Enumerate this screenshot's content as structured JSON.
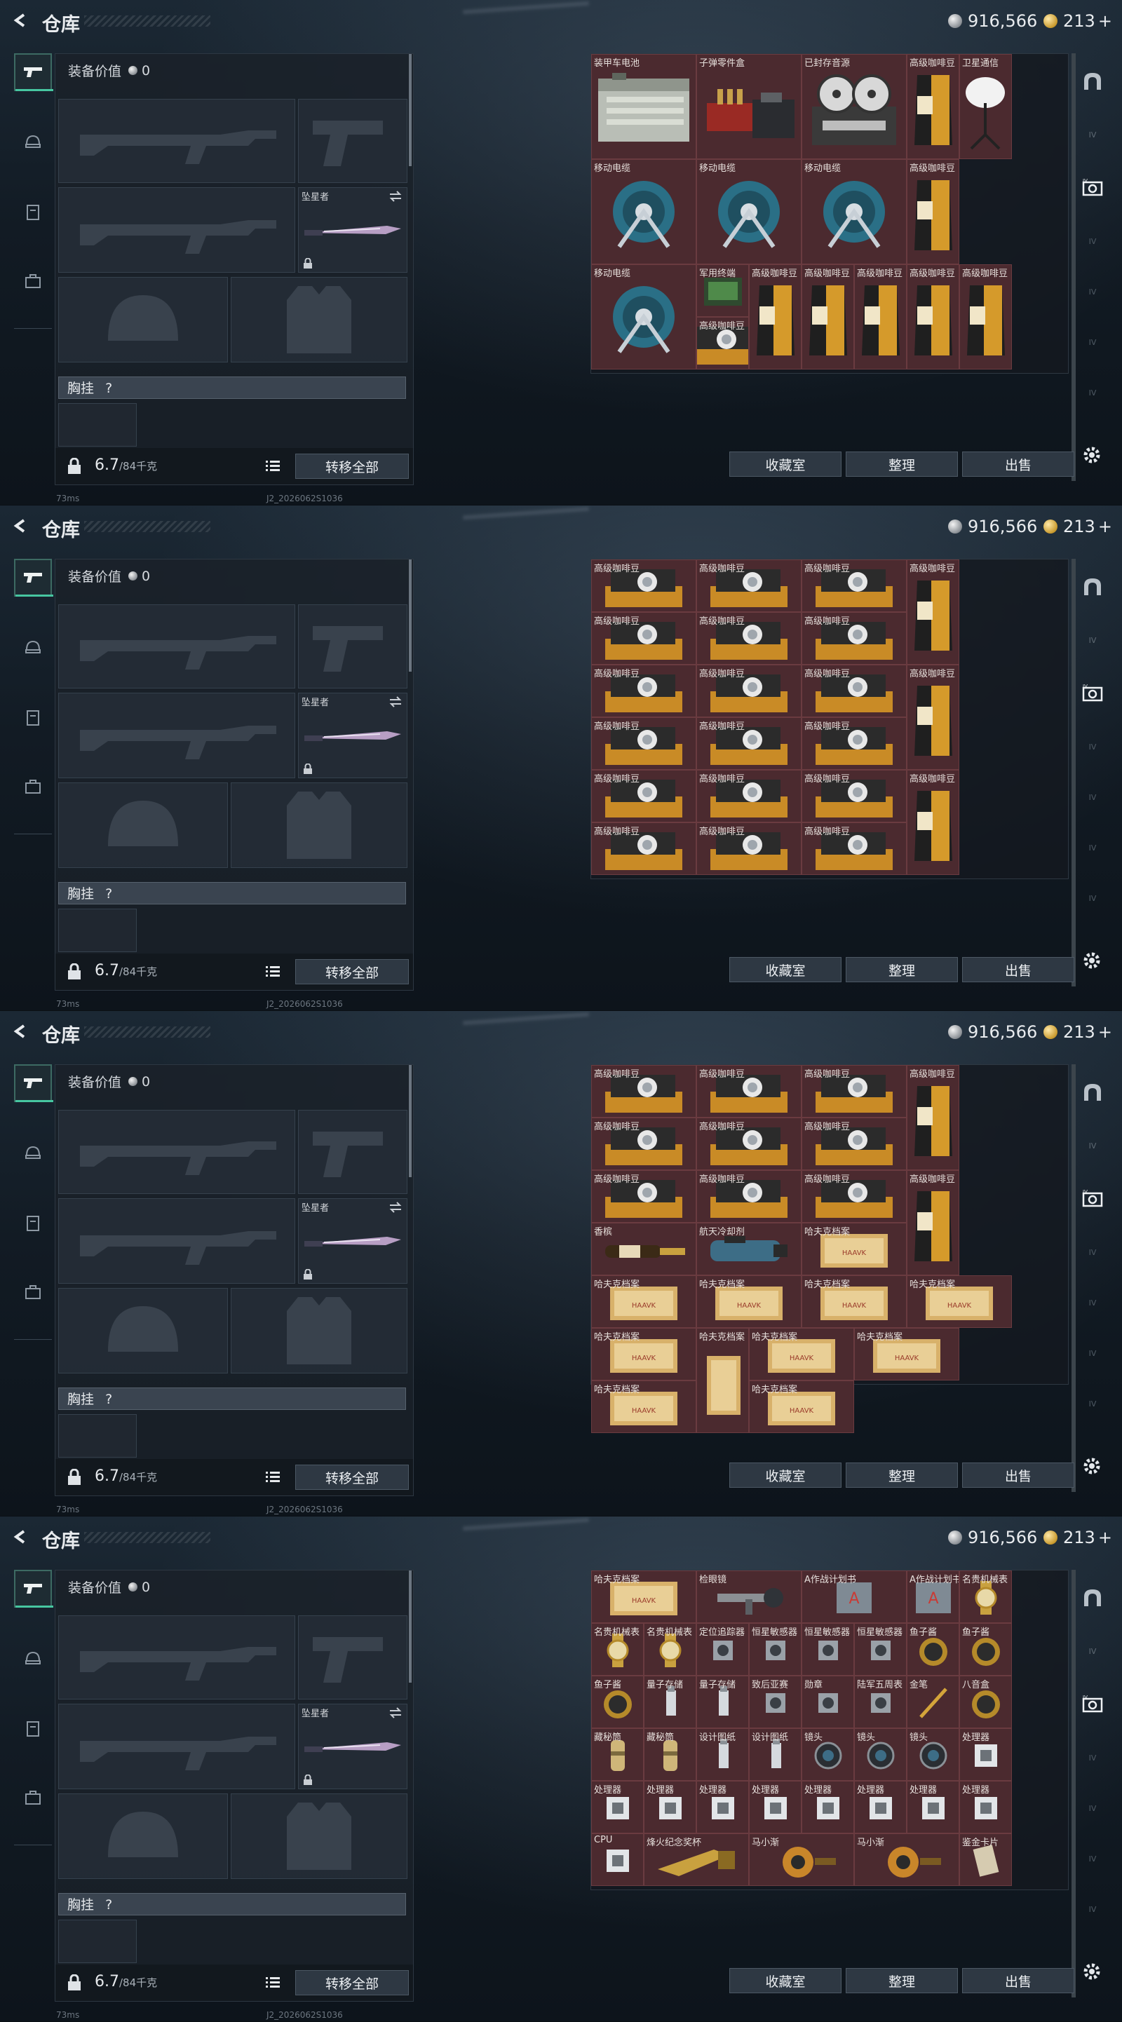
{
  "header": {
    "title": "仓库",
    "silver": "916,566",
    "gold": "213",
    "gold_suffix": "+"
  },
  "left_nav": [
    "weapon",
    "helmet",
    "armor",
    "backpack"
  ],
  "equipment": {
    "value_label": "装备价值",
    "value": "0",
    "melee_name": "坠星者",
    "chest_label": "胸挂",
    "chest_hint": "?",
    "weight": "6.7",
    "weight_cap": "/84千克",
    "transfer_all": "转移全部"
  },
  "inventory_buttons": {
    "collection": "收藏室",
    "sort": "整理",
    "sell": "出售"
  },
  "footer": {
    "ping": "73ms",
    "build": "J2_2026062S1036"
  },
  "views": [
    {
      "items": [
        {
          "label": "装甲车电池",
          "w": 2,
          "h": 2,
          "art": "battery"
        },
        {
          "label": "子弹零件盒",
          "w": 2,
          "h": 2,
          "art": "ammo"
        },
        {
          "label": "已封存音源",
          "w": 2,
          "h": 2,
          "art": "reel"
        },
        {
          "label": "高级咖啡豆",
          "w": 1,
          "h": 2,
          "art": "coffee"
        },
        {
          "label": "卫星通信",
          "w": 1,
          "h": 2,
          "art": "dish"
        },
        {
          "label": "移动电缆",
          "w": 2,
          "h": 2,
          "art": "cable"
        },
        {
          "label": "移动电缆",
          "w": 2,
          "h": 2,
          "art": "cable"
        },
        {
          "label": "移动电缆",
          "w": 2,
          "h": 2,
          "art": "cable"
        },
        {
          "label": "高级咖啡豆",
          "w": 1,
          "h": 2,
          "art": "coffee"
        },
        {
          "label": "移动电缆",
          "w": 2,
          "h": 2,
          "art": "cable"
        },
        {
          "label": "军用终端",
          "w": 1,
          "h": 1,
          "art": "terminal"
        },
        {
          "label": "高级咖啡豆",
          "w": 1,
          "h": 2,
          "art": "coffee"
        },
        {
          "label": "高级咖啡豆",
          "w": 1,
          "h": 2,
          "art": "coffee"
        },
        {
          "label": "高级咖啡豆",
          "w": 1,
          "h": 2,
          "art": "coffee"
        },
        {
          "label": "高级咖啡豆",
          "w": 1,
          "h": 2,
          "art": "coffee"
        },
        {
          "label": "高级咖啡豆",
          "w": 1,
          "h": 2,
          "art": "coffee"
        },
        {
          "label": "高级咖啡豆",
          "w": 1,
          "h": 1,
          "art": "coffeebox"
        }
      ]
    },
    {
      "items": [
        {
          "label": "高级咖啡豆",
          "w": 2,
          "h": 1,
          "art": "coffeebox"
        },
        {
          "label": "高级咖啡豆",
          "w": 2,
          "h": 1,
          "art": "coffeebox"
        },
        {
          "label": "高级咖啡豆",
          "w": 2,
          "h": 1,
          "art": "coffeebox"
        },
        {
          "label": "高级咖啡豆",
          "w": 1,
          "h": 2,
          "art": "coffee"
        },
        {
          "label": "高级咖啡豆",
          "w": 2,
          "h": 1,
          "art": "coffeebox"
        },
        {
          "label": "高级咖啡豆",
          "w": 2,
          "h": 1,
          "art": "coffeebox"
        },
        {
          "label": "高级咖啡豆",
          "w": 2,
          "h": 1,
          "art": "coffeebox"
        },
        {
          "label": "高级咖啡豆",
          "w": 2,
          "h": 1,
          "art": "coffeebox"
        },
        {
          "label": "高级咖啡豆",
          "w": 2,
          "h": 1,
          "art": "coffeebox"
        },
        {
          "label": "高级咖啡豆",
          "w": 2,
          "h": 1,
          "art": "coffeebox"
        },
        {
          "label": "高级咖啡豆",
          "w": 1,
          "h": 2,
          "art": "coffee"
        },
        {
          "label": "高级咖啡豆",
          "w": 2,
          "h": 1,
          "art": "coffeebox"
        },
        {
          "label": "高级咖啡豆",
          "w": 2,
          "h": 1,
          "art": "coffeebox"
        },
        {
          "label": "高级咖啡豆",
          "w": 2,
          "h": 1,
          "art": "coffeebox"
        },
        {
          "label": "高级咖啡豆",
          "w": 2,
          "h": 1,
          "art": "coffeebox"
        },
        {
          "label": "高级咖啡豆",
          "w": 2,
          "h": 1,
          "art": "coffeebox"
        },
        {
          "label": "高级咖啡豆",
          "w": 2,
          "h": 1,
          "art": "coffeebox"
        },
        {
          "label": "高级咖啡豆",
          "w": 1,
          "h": 2,
          "art": "coffee"
        },
        {
          "label": "高级咖啡豆",
          "w": 2,
          "h": 1,
          "art": "coffeebox"
        },
        {
          "label": "高级咖啡豆",
          "w": 2,
          "h": 1,
          "art": "coffeebox"
        },
        {
          "label": "高级咖啡豆",
          "w": 2,
          "h": 1,
          "art": "coffeebox"
        }
      ]
    },
    {
      "items": [
        {
          "label": "高级咖啡豆",
          "w": 2,
          "h": 1,
          "art": "coffeebox"
        },
        {
          "label": "高级咖啡豆",
          "w": 2,
          "h": 1,
          "art": "coffeebox"
        },
        {
          "label": "高级咖啡豆",
          "w": 2,
          "h": 1,
          "art": "coffeebox"
        },
        {
          "label": "高级咖啡豆",
          "w": 1,
          "h": 2,
          "art": "coffee"
        },
        {
          "label": "高级咖啡豆",
          "w": 2,
          "h": 1,
          "art": "coffeebox"
        },
        {
          "label": "高级咖啡豆",
          "w": 2,
          "h": 1,
          "art": "coffeebox"
        },
        {
          "label": "高级咖啡豆",
          "w": 2,
          "h": 1,
          "art": "coffeebox"
        },
        {
          "label": "高级咖啡豆",
          "w": 2,
          "h": 1,
          "art": "coffeebox"
        },
        {
          "label": "高级咖啡豆",
          "w": 2,
          "h": 1,
          "art": "coffeebox"
        },
        {
          "label": "高级咖啡豆",
          "w": 2,
          "h": 1,
          "art": "coffeebox"
        },
        {
          "label": "高级咖啡豆",
          "w": 1,
          "h": 2,
          "art": "coffee"
        },
        {
          "label": "香槟",
          "w": 2,
          "h": 1,
          "art": "bottle"
        },
        {
          "label": "航天冷却剂",
          "w": 2,
          "h": 1,
          "art": "tank"
        },
        {
          "label": "哈夫克档案",
          "w": 2,
          "h": 1,
          "art": "file"
        },
        {
          "label": "哈夫克档案",
          "w": 2,
          "h": 1,
          "art": "file"
        },
        {
          "label": "哈夫克档案",
          "w": 2,
          "h": 1,
          "art": "file"
        },
        {
          "label": "哈夫克档案",
          "w": 2,
          "h": 1,
          "art": "file"
        },
        {
          "label": "哈夫克档案",
          "w": 2,
          "h": 1,
          "art": "file"
        },
        {
          "label": "哈夫克档案",
          "w": 2,
          "h": 1,
          "art": "file"
        },
        {
          "label": "哈夫克档案",
          "w": 1,
          "h": 2,
          "art": "filev"
        },
        {
          "label": "哈夫克档案",
          "w": 2,
          "h": 1,
          "art": "file"
        },
        {
          "label": "哈夫克档案",
          "w": 2,
          "h": 1,
          "art": "file"
        },
        {
          "label": "哈夫克档案",
          "w": 2,
          "h": 1,
          "art": "file"
        },
        {
          "label": "哈夫克档案",
          "w": 2,
          "h": 1,
          "art": "file"
        }
      ]
    },
    {
      "items": [
        {
          "label": "哈夫克档案",
          "w": 2,
          "h": 1,
          "art": "file"
        },
        {
          "label": "检眼镜",
          "w": 2,
          "h": 1,
          "art": "tool"
        },
        {
          "label": "A作战计划书",
          "w": 2,
          "h": 1,
          "art": "book"
        },
        {
          "label": "A作战计划书",
          "w": 1,
          "h": 1,
          "art": "book"
        },
        {
          "label": "名贵机械表",
          "w": 1,
          "h": 1,
          "art": "watch"
        },
        {
          "label": "名贵机械表",
          "w": 1,
          "h": 1,
          "art": "watch"
        },
        {
          "label": "名贵机械表",
          "w": 1,
          "h": 1,
          "art": "watch"
        },
        {
          "label": "定位追踪器",
          "w": 1,
          "h": 1,
          "art": "gadget"
        },
        {
          "label": "恒星敏感器",
          "w": 1,
          "h": 1,
          "art": "gadget"
        },
        {
          "label": "恒星敏感器",
          "w": 1,
          "h": 1,
          "art": "gadget"
        },
        {
          "label": "恒星敏感器",
          "w": 1,
          "h": 1,
          "art": "gadget"
        },
        {
          "label": "鱼子酱",
          "w": 1,
          "h": 1,
          "art": "tin"
        },
        {
          "label": "鱼子酱",
          "w": 1,
          "h": 1,
          "art": "tin"
        },
        {
          "label": "鱼子酱",
          "w": 1,
          "h": 1,
          "art": "tin"
        },
        {
          "label": "量子存储",
          "w": 1,
          "h": 1,
          "art": "usb"
        },
        {
          "label": "量子存储",
          "w": 1,
          "h": 1,
          "art": "usb"
        },
        {
          "label": "致后亚赛",
          "w": 1,
          "h": 1,
          "art": "gadget"
        },
        {
          "label": "勋章",
          "w": 1,
          "h": 1,
          "art": "gadget"
        },
        {
          "label": "陆军五周表",
          "w": 1,
          "h": 1,
          "art": "gadget"
        },
        {
          "label": "金笔",
          "w": 1,
          "h": 1,
          "art": "pen"
        },
        {
          "label": "八音盒",
          "w": 1,
          "h": 1,
          "art": "tin"
        },
        {
          "label": "藏秘筒",
          "w": 1,
          "h": 1,
          "art": "tube"
        },
        {
          "label": "藏秘筒",
          "w": 1,
          "h": 1,
          "art": "tube"
        },
        {
          "label": "设计图纸",
          "w": 1,
          "h": 1,
          "art": "usb"
        },
        {
          "label": "设计图纸",
          "w": 1,
          "h": 1,
          "art": "usb"
        },
        {
          "label": "镜头",
          "w": 1,
          "h": 1,
          "art": "lens"
        },
        {
          "label": "镜头",
          "w": 1,
          "h": 1,
          "art": "lens"
        },
        {
          "label": "镜头",
          "w": 1,
          "h": 1,
          "art": "lens"
        },
        {
          "label": "处理器",
          "w": 1,
          "h": 1,
          "art": "chip"
        },
        {
          "label": "处理器",
          "w": 1,
          "h": 1,
          "art": "chip"
        },
        {
          "label": "处理器",
          "w": 1,
          "h": 1,
          "art": "chip"
        },
        {
          "label": "处理器",
          "w": 1,
          "h": 1,
          "art": "chip"
        },
        {
          "label": "处理器",
          "w": 1,
          "h": 1,
          "art": "chip"
        },
        {
          "label": "处理器",
          "w": 1,
          "h": 1,
          "art": "chip"
        },
        {
          "label": "处理器",
          "w": 1,
          "h": 1,
          "art": "chip"
        },
        {
          "label": "处理器",
          "w": 1,
          "h": 1,
          "art": "chip"
        },
        {
          "label": "处理器",
          "w": 1,
          "h": 1,
          "art": "chip"
        },
        {
          "label": "CPU",
          "w": 1,
          "h": 1,
          "art": "chip"
        },
        {
          "label": "烽火纪念奖杯",
          "w": 2,
          "h": 1,
          "art": "trophy"
        },
        {
          "label": "马小渐",
          "w": 2,
          "h": 1,
          "art": "toy"
        },
        {
          "label": "马小渐",
          "w": 2,
          "h": 1,
          "art": "toy"
        },
        {
          "label": "鉴金卡片",
          "w": 1,
          "h": 1,
          "art": "card"
        }
      ]
    }
  ]
}
